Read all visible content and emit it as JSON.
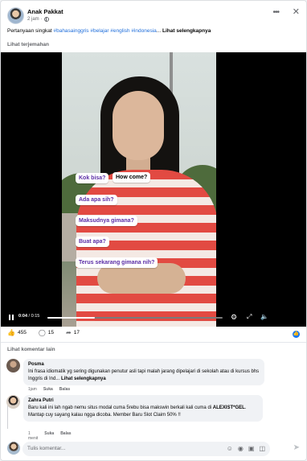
{
  "post": {
    "author": "Anak Pakkat",
    "time": "2 jam",
    "dot": "·",
    "caption_text": "Pertanyaan singkat",
    "hashtags": "#bahasainggris #belajar #english #indonesia",
    "ellipsis": "...",
    "see_more": "Lihat selengkapnya",
    "translate": "Lihat terjemahan"
  },
  "video": {
    "bubbles": [
      {
        "text": "Kok bisa?",
        "style": "purple"
      },
      {
        "text": "How come?",
        "style": "dark"
      },
      {
        "text": "Ada apa sih?",
        "style": "purple"
      },
      {
        "text": "Maksudnya gimana?",
        "style": "purple"
      },
      {
        "text": "Buat apa?",
        "style": "purple"
      },
      {
        "text": "Terus sekarang gimana nih?",
        "style": "purple"
      }
    ],
    "current_time": "0:04",
    "separator": " / ",
    "duration": "0:15",
    "progress": 0.27
  },
  "reactions": {
    "likes": "455",
    "comments": "15",
    "shares": "17"
  },
  "other_comments_label": "Lihat komentar lain",
  "comments": [
    {
      "name": "Posma",
      "text": "Ini frasa idiomatik yg sering digunakan penutur asli tapi malah jarang dipelajari di sekolah atau di kursus bhs Inggris di Ind...",
      "see_more": "Lihat selengkapnya",
      "time": "1jam",
      "like": "Suka",
      "reply": "Balas"
    },
    {
      "name": "Zahra Putri",
      "text_before": "Baru kali ini lah ngab nemu situs modal cuma 5rebu bisa makswin berkali kali cuma di ",
      "text_bold": "ALEXIST*GEL",
      "text_after": ". Mantap cuy sayang kalau ngga dicoba. Member Baru Slot Claim 50% !!",
      "time": "1 menit",
      "like": "Suka",
      "reply": "Balas"
    }
  ],
  "composer": {
    "placeholder": "Tulis komentar..."
  },
  "colors": {
    "link": "#216fdb",
    "facebook_blue": "#1877f2",
    "bubble_text": "#5b2ea6",
    "shirt_red": "#e24a42"
  }
}
